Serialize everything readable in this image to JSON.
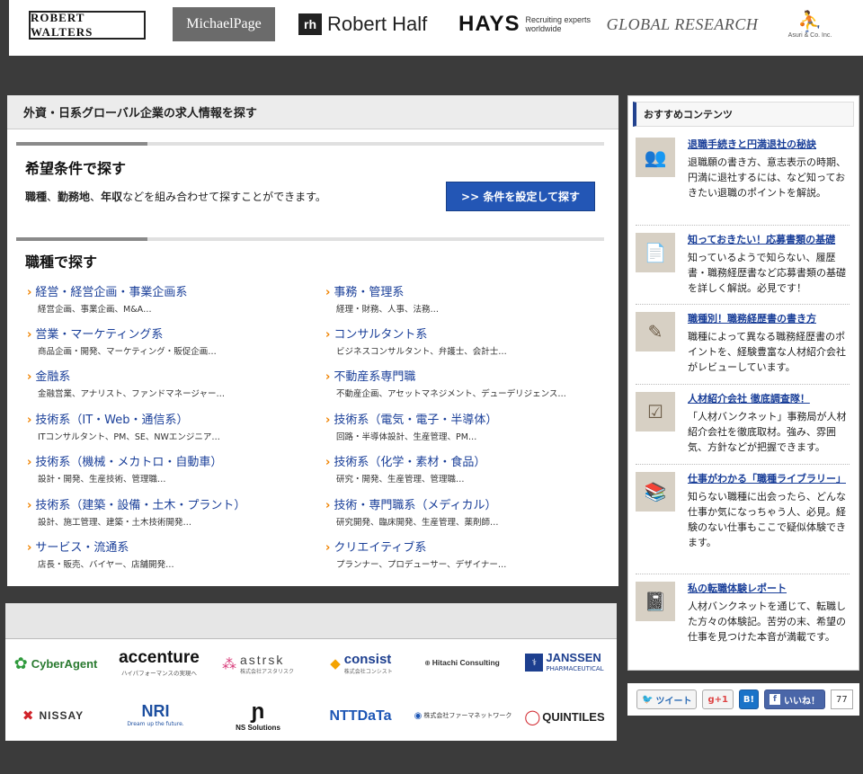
{
  "top_logos": {
    "robert_walters": "ROBERT WALTERS",
    "michael_page": "MichaelPage",
    "robert_half_mark": "rh",
    "robert_half": "Robert Half",
    "hays": "HAYS",
    "hays_tagline": "Recruiting experts worldwide",
    "global_research": "GLOBAL RESEARCH",
    "asuri": "Asuri & Co. Inc."
  },
  "main": {
    "header": "外資・日系グローバル企業の求人情報を探す",
    "search_title": "希望条件で探す",
    "search_desc_bold_1": "職種",
    "search_desc_sep_1": "、",
    "search_desc_bold_2": "勤務地",
    "search_desc_sep_2": "、",
    "search_desc_bold_3": "年収",
    "search_desc_rest": "などを組み合わせて探すことができます。",
    "search_button": ">> 条件を設定して探す",
    "category_title": "職種で探す",
    "categories": [
      {
        "title": "経営・経営企画・事業企画系",
        "sub": "経営企画、事業企画、M&A…"
      },
      {
        "title": "事務・管理系",
        "sub": "経理・財務、人事、法務…"
      },
      {
        "title": "営業・マーケティング系",
        "sub": "商品企画・開発、マーケティング・販促企画…"
      },
      {
        "title": "コンサルタント系",
        "sub": "ビジネスコンサルタント、弁護士、会計士…"
      },
      {
        "title": "金融系",
        "sub": "金融営業、アナリスト、ファンドマネージャー…"
      },
      {
        "title": "不動産系専門職",
        "sub": "不動産企画、アセットマネジメント、デューデリジェンス…"
      },
      {
        "title": "技術系（IT・Web・通信系）",
        "sub": "ITコンサルタント、PM、SE、NWエンジニア…"
      },
      {
        "title": "技術系（電気・電子・半導体）",
        "sub": "回路・半導体設計、生産管理、PM…"
      },
      {
        "title": "技術系（機械・メカトロ・自動車）",
        "sub": "設計・開発、生産技術、管理職…"
      },
      {
        "title": "技術系（化学・素材・食品）",
        "sub": "研究・開発、生産管理、管理職…"
      },
      {
        "title": "技術系（建築・設備・土木・プラント）",
        "sub": "設計、施工管理、建築・土木技術開発…"
      },
      {
        "title": "技術・専門職系（メディカル）",
        "sub": "研究開発、臨床開発、生産管理、薬剤師…"
      },
      {
        "title": "サービス・流通系",
        "sub": "店長・販売、バイヤー、店舗開発…"
      },
      {
        "title": "クリエイティブ系",
        "sub": "プランナー、プロデューサー、デザイナー…"
      }
    ]
  },
  "partners": {
    "cyberagent": "CyberAgent",
    "accenture": "accenture",
    "accenture_sub": "ハイパフォーマンスの実現へ",
    "astrsk": "astrsk",
    "astrsk_sub": "株式会社アスタリスク",
    "consist": "consist",
    "consist_sub": "株式会社コンシスト",
    "hitachi": "Hitachi Consulting",
    "janssen": "JANSSEN",
    "janssen_sub": "PHARMACEUTICAL",
    "nissay": "NISSAY",
    "nri": "NRI",
    "nri_sub": "Dream up the future.",
    "ns": "NS Solutions",
    "nttdata": "NTTDaTa",
    "pharmanet": "株式会社ファーマネットワーク",
    "quintiles": "QUINTILES"
  },
  "sidebar": {
    "header": "おすすめコンテンツ",
    "items": [
      {
        "link": "退職手続きと円満退社の秘訣",
        "desc": "退職願の書き方、意志表示の時期、円満に退社するには、など知っておきたい退職のポイントを解説。"
      },
      {
        "link": "知っておきたい！応募書類の基礎",
        "desc": "知っているようで知らない、履歴書・職務経歴書など応募書類の基礎を詳しく解説。必見です！"
      },
      {
        "link": "職種別！職務経歴書の書き方",
        "desc": "職種によって異なる職務経歴書のポイントを、経験豊富な人材紹介会社がレビューしています。"
      },
      {
        "link": "人材紹介会社 徹底調査隊！",
        "desc": "「人材バンクネット」事務局が人材紹介会社を徹底取材。強み、雰囲気、方針などが把握できます。"
      },
      {
        "link": "仕事がわかる「職種ライブラリー」",
        "desc": "知らない職種に出会ったら、どんな仕事か気になっちゃう人、必見。経験のない仕事もここで疑似体験できます。"
      },
      {
        "link": "私の転職体験レポート",
        "desc": "人材バンクネットを通じて、転職した方々の体験記。苦労の末、希望の仕事を見つけた本音が満載です。"
      }
    ]
  },
  "social": {
    "tweet": "ツイート",
    "gplus": "g+1",
    "hatena": "B!",
    "like": "いいね！",
    "like_count": "77"
  }
}
